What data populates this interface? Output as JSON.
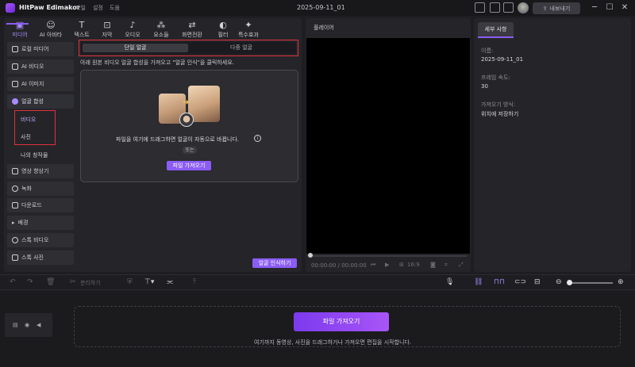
{
  "app": {
    "name": "HitPaw Edimakor",
    "menu": [
      "파일",
      "설정",
      "도움"
    ],
    "doc_title": "2025-09-11_01",
    "export_label": "내보내기"
  },
  "tabs": [
    {
      "label": "미디어",
      "icon": "media-icon"
    },
    {
      "label": "AI 아바타",
      "icon": "avatar-icon"
    },
    {
      "label": "텍스트",
      "icon": "text-icon"
    },
    {
      "label": "자막",
      "icon": "subtitle-icon"
    },
    {
      "label": "오디오",
      "icon": "audio-icon"
    },
    {
      "label": "요소들",
      "icon": "elements-icon"
    },
    {
      "label": "화면전환",
      "icon": "transition-icon"
    },
    {
      "label": "필터",
      "icon": "filter-icon"
    },
    {
      "label": "특수효과",
      "icon": "effects-icon"
    }
  ],
  "sidebar": {
    "items": [
      {
        "label": "로컬 미디어"
      },
      {
        "label": "AI 비디오"
      },
      {
        "label": "AI 이미지"
      },
      {
        "label": "얼굴 합성"
      },
      {
        "label": "영상 향상기"
      },
      {
        "label": "녹화"
      },
      {
        "label": "다운로드"
      },
      {
        "label": "배경"
      },
      {
        "label": "스톡 비디오"
      },
      {
        "label": "스톡 사진"
      }
    ],
    "sub_items": [
      "비디오",
      "사진",
      "나의 창작물"
    ]
  },
  "face_swap": {
    "seg_single": "단일 얼굴",
    "seg_multi": "다중 얼굴",
    "instruction": "아래 원본 비디오 얼굴 합성을 가져오고 \"얼굴 인식\"을 클릭하세요.",
    "drop_text": "파일을 여기에 드래그하면 얼굴이 자동으로 바뀝니다.",
    "or_label": "또는",
    "import_label": "파일 가져오기",
    "recognize_label": "얼굴 인식하기"
  },
  "player": {
    "title": "플레이어",
    "time": "00:00:00 / 00:00:00",
    "ratio": "16:9"
  },
  "details": {
    "tab": "세부 사항",
    "name_label": "이름:",
    "name_value": "2025-09-11_01",
    "fps_label": "프레임 속도:",
    "fps_value": "30",
    "import_label": "가져오기 방식:",
    "import_value": "위치에 저장하기"
  },
  "toolbar": {
    "split_label": "분리하기"
  },
  "timeline": {
    "import_label": "파일 가져오기",
    "hint": "여기까지 동영상, 사진을 드래그하거나 가져오면 편집을 시작합니다."
  },
  "colors": {
    "accent": "#8b5cf6",
    "highlight": "#e0313b"
  }
}
